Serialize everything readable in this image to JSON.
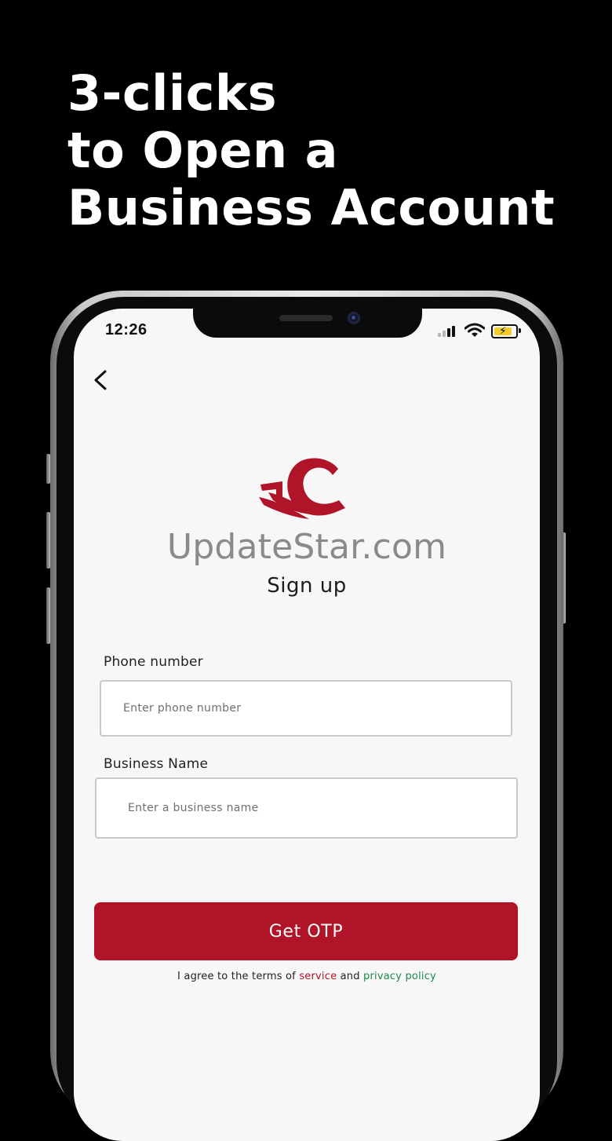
{
  "headline": [
    "3-clicks",
    "to Open a",
    "Business Account"
  ],
  "status_bar": {
    "time": "12:26",
    "icons": [
      "signal-icon",
      "wifi-icon",
      "battery-charging-icon"
    ]
  },
  "brand": {
    "name": "UpdateStar.com"
  },
  "page": {
    "title": "Sign up"
  },
  "form": {
    "phone": {
      "label": "Phone number",
      "placeholder": "Enter phone number"
    },
    "business": {
      "label": "Business Name",
      "placeholder": "Enter a business name"
    },
    "submit_label": "Get OTP"
  },
  "terms": {
    "prefix": "I agree to the terms of",
    "service": "service",
    "and": "and",
    "privacy": "privacy policy"
  },
  "colors": {
    "accent": "#b01428",
    "service_link": "#b01428",
    "privacy_link": "#1f8a4c",
    "background": "#000000",
    "screen": "#f7f7f7"
  }
}
